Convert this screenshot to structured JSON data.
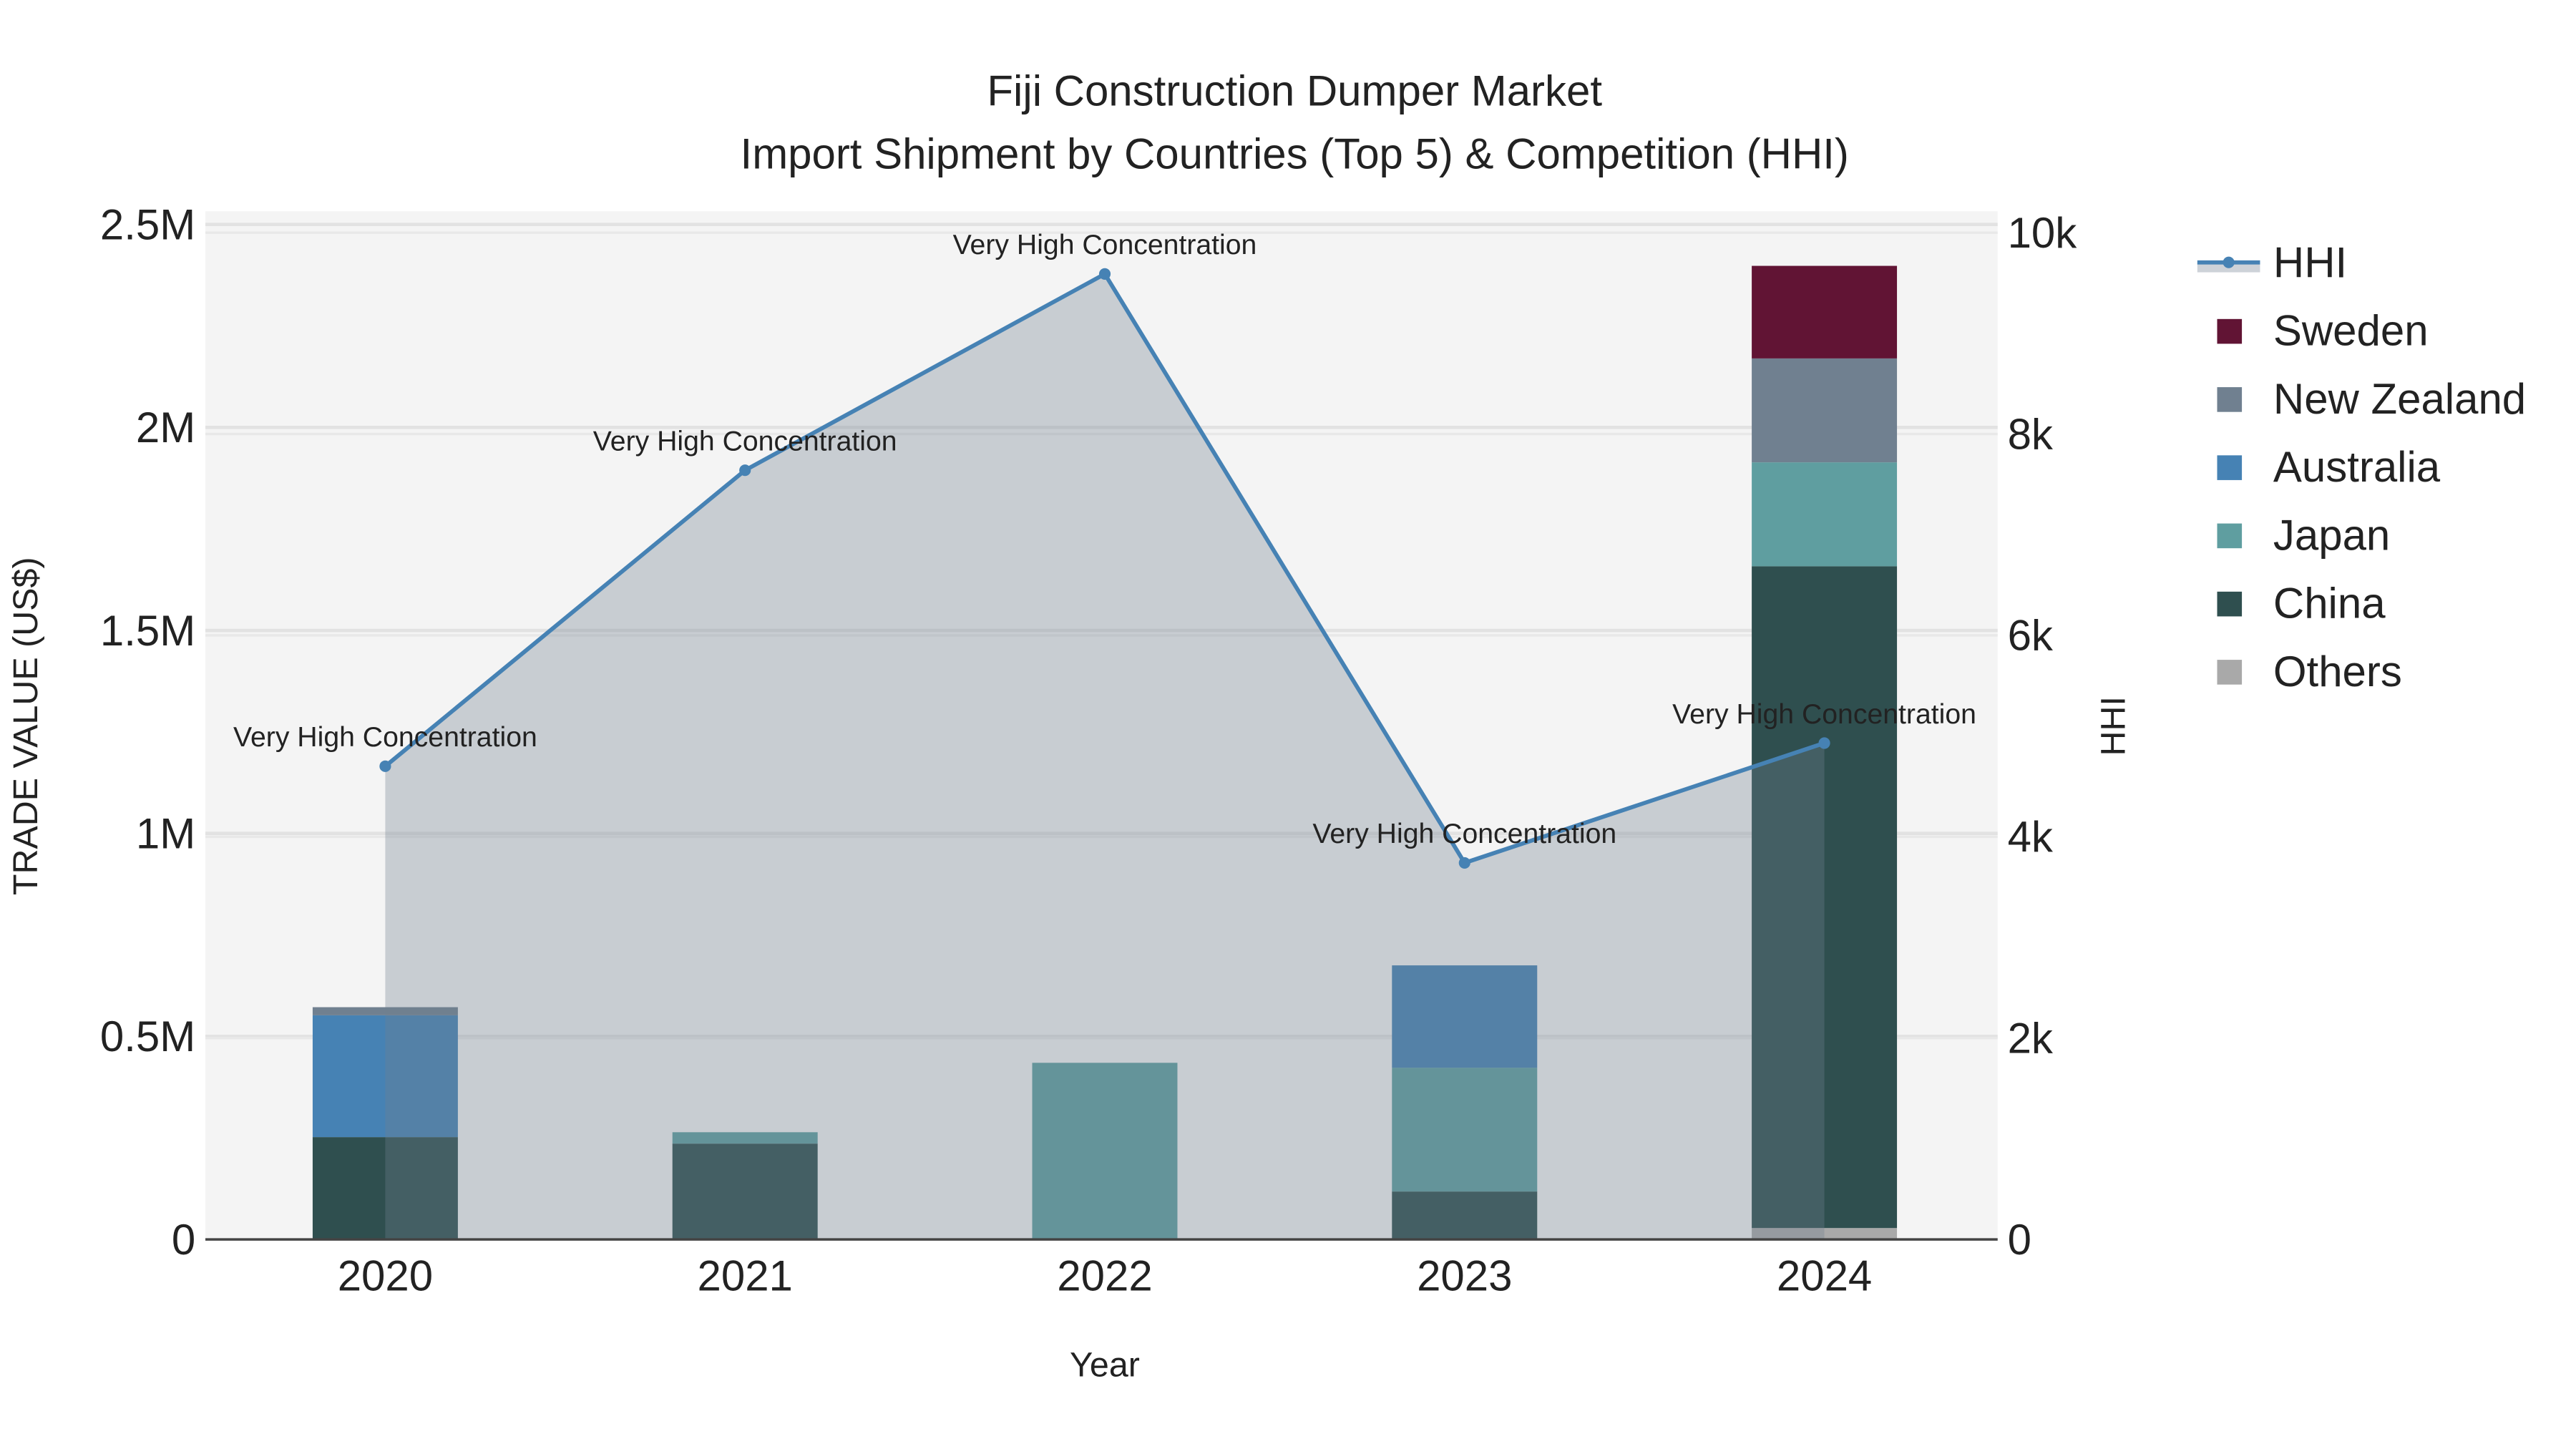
{
  "chart_data": {
    "type": "bar",
    "title": "Fiji Construction Dumper Market",
    "subtitle": "Import Shipment by Countries (Top 5) & Competition (HHI)",
    "xlabel": "Year",
    "ylabel": "TRADE VALUE (US$)",
    "y2label": "HHI",
    "categories": [
      "2020",
      "2021",
      "2022",
      "2023",
      "2024"
    ],
    "ylim": [
      0,
      2500000
    ],
    "y2lim": [
      0,
      10000
    ],
    "yticks": [
      {
        "v": 0,
        "label": "0"
      },
      {
        "v": 500000,
        "label": "0.5M"
      },
      {
        "v": 1000000,
        "label": "1M"
      },
      {
        "v": 1500000,
        "label": "1.5M"
      },
      {
        "v": 2000000,
        "label": "2M"
      },
      {
        "v": 2500000,
        "label": "2.5M"
      }
    ],
    "y2ticks": [
      {
        "v": 0,
        "label": "0"
      },
      {
        "v": 2000,
        "label": "2k"
      },
      {
        "v": 4000,
        "label": "4k"
      },
      {
        "v": 6000,
        "label": "6k"
      },
      {
        "v": 8000,
        "label": "8k"
      },
      {
        "v": 10000,
        "label": "10k"
      }
    ],
    "grid": true,
    "stacked": true,
    "legend_position": "right",
    "series": [
      {
        "name": "Others",
        "color": "#a9a9a9",
        "values": [
          0,
          0,
          0,
          0,
          28000
        ]
      },
      {
        "name": "China",
        "color": "#2f4f4f",
        "values": [
          252000,
          236000,
          0,
          118000,
          1630000
        ]
      },
      {
        "name": "Japan",
        "color": "#5f9ea0",
        "values": [
          0,
          28000,
          435000,
          305000,
          256000
        ]
      },
      {
        "name": "Australia",
        "color": "#4682b4",
        "values": [
          300000,
          0,
          0,
          252000,
          0
        ]
      },
      {
        "name": "New Zealand",
        "color": "#708090",
        "values": [
          20000,
          0,
          0,
          0,
          256000
        ]
      },
      {
        "name": "Sweden",
        "color": "#611434",
        "values": [
          0,
          0,
          0,
          0,
          228000
        ]
      }
    ],
    "line": {
      "name": "HHI",
      "color": "#4682b4",
      "fill": "rgba(112,128,144,0.33)",
      "values": [
        4700,
        7640,
        9590,
        3740,
        4930
      ],
      "annotations": [
        "Very High Concentration",
        "Very High Concentration",
        "Very High Concentration",
        "Very High Concentration",
        "Very High Concentration"
      ]
    },
    "legend_order": [
      "HHI",
      "Sweden",
      "New Zealand",
      "Australia",
      "Japan",
      "China",
      "Others"
    ]
  }
}
